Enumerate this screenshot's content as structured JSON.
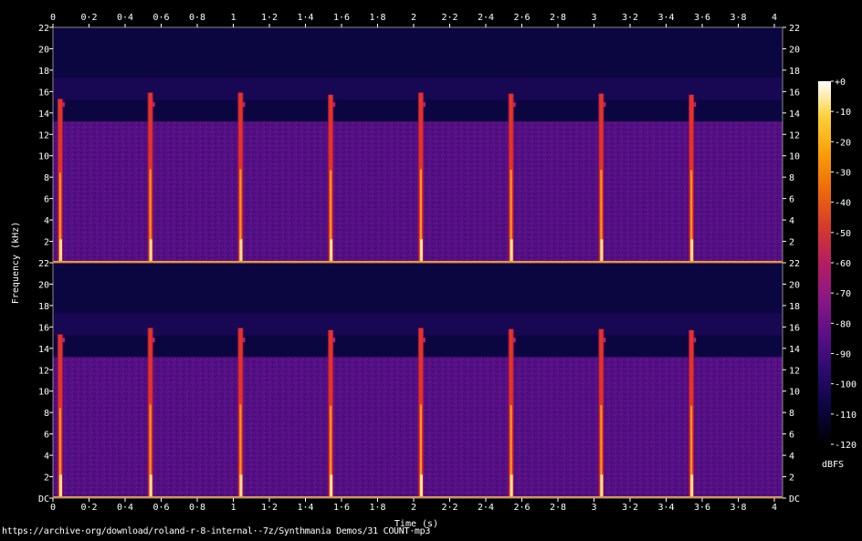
{
  "chart_data": {
    "type": "heatmap",
    "title": "",
    "xlabel": "Time (s)",
    "ylabel": "Frequency (kHz)",
    "xlim": [
      0,
      4.05
    ],
    "ylim": [
      0,
      22
    ],
    "x_ticks": [
      "0",
      "0·2",
      "0·4",
      "0·6",
      "0·8",
      "1",
      "1·2",
      "1·4",
      "1·6",
      "1·8",
      "2",
      "2·2",
      "2·4",
      "2·6",
      "2·8",
      "3",
      "3·2",
      "3·4",
      "3·6",
      "3·8",
      "4"
    ],
    "y_ticks": [
      "DC",
      "2",
      "4",
      "6",
      "8",
      "10",
      "12",
      "14",
      "16",
      "18",
      "20",
      "22"
    ],
    "channels": [
      "left",
      "right"
    ],
    "colorbar": {
      "label": "dBFS",
      "range": [
        -120,
        0
      ],
      "ticks": [
        "+0",
        "-10",
        "-20",
        "-30",
        "-40",
        "-50",
        "-60",
        "-70",
        "-80",
        "-90",
        "-100",
        "-110",
        "-120"
      ],
      "colormap": [
        "#000000",
        "#0b0540",
        "#2a0a6e",
        "#5a0f86",
        "#8a1786",
        "#b41e62",
        "#d63a2c",
        "#ee6a0a",
        "#f89e08",
        "#fbd036",
        "#ffffff"
      ]
    },
    "background_level_dbfs": -85,
    "upper_band_level_dbfs": -108,
    "lowpass_cutoff_khz": 13.2,
    "transients": [
      {
        "time_s": 0.04,
        "top_khz": 15.3
      },
      {
        "time_s": 0.54,
        "top_khz": 15.9
      },
      {
        "time_s": 1.04,
        "top_khz": 15.9
      },
      {
        "time_s": 1.54,
        "top_khz": 15.7
      },
      {
        "time_s": 2.04,
        "top_khz": 15.9
      },
      {
        "time_s": 2.54,
        "top_khz": 15.8
      },
      {
        "time_s": 3.04,
        "top_khz": 15.8
      },
      {
        "time_s": 3.54,
        "top_khz": 15.7
      }
    ]
  },
  "footer": {
    "source_url": "https://archive·org/download/roland-r-8-internal·-7z/Synthmania Demos/31 COUNT·mp3"
  }
}
